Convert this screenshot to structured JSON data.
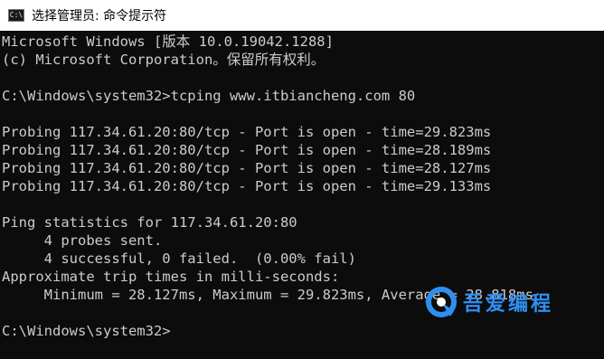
{
  "window": {
    "title": "选择管理员: 命令提示符",
    "icon": "cmd-icon",
    "icon_glyph": "C:\\"
  },
  "console": {
    "lines": [
      "Microsoft Windows [版本 10.0.19042.1288]",
      "(c) Microsoft Corporation。保留所有权利。",
      "",
      "C:\\Windows\\system32>tcping www.itbiancheng.com 80",
      "",
      "Probing 117.34.61.20:80/tcp - Port is open - time=29.823ms",
      "Probing 117.34.61.20:80/tcp - Port is open - time=28.189ms",
      "Probing 117.34.61.20:80/tcp - Port is open - time=28.127ms",
      "Probing 117.34.61.20:80/tcp - Port is open - time=29.133ms",
      "",
      "Ping statistics for 117.34.61.20:80",
      "     4 probes sent.",
      "     4 successful, 0 failed.  (0.00% fail)",
      "Approximate trip times in milli-seconds:",
      "     Minimum = 28.127ms, Maximum = 29.823ms, Average = 28.818ms",
      "",
      "C:\\Windows\\system32>"
    ]
  },
  "watermark": {
    "text": "吾爱编程",
    "color": "#2f8ff0"
  }
}
